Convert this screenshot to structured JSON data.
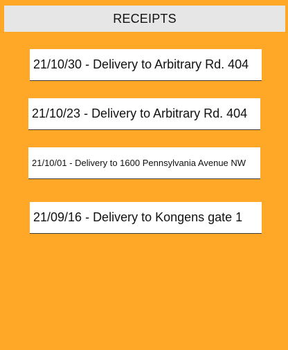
{
  "header": {
    "title": "RECEIPTS"
  },
  "colors": {
    "background": "#FFA726",
    "header": "#E6E6E6",
    "card": "#FFFFFF"
  },
  "receipts": [
    {
      "label": "21/10/30 - Delivery to Arbitrary Rd. 404"
    },
    {
      "label": "21/10/23 - Delivery to Arbitrary Rd. 404"
    },
    {
      "label": "21/10/01 - Delivery to 1600 Pennsylvania Avenue NW"
    },
    {
      "label": "21/09/16 - Delivery to Kongens gate 1"
    }
  ]
}
